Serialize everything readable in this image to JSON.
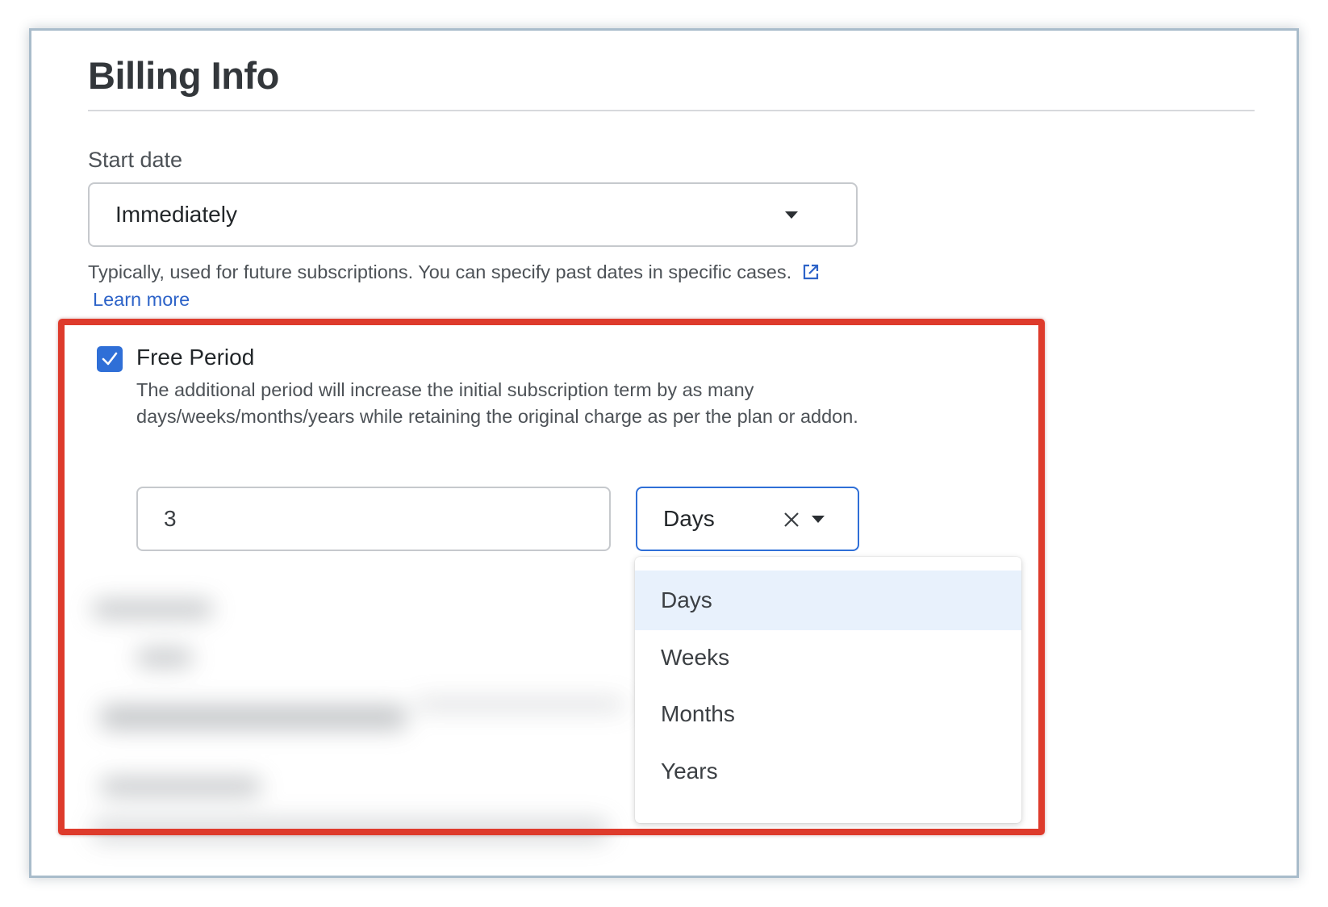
{
  "billing": {
    "title": "Billing Info",
    "start_date": {
      "label": "Start date",
      "value": "Immediately",
      "helper_text": "Typically, used for future subscriptions. You can specify past dates in specific cases.",
      "learn_more": "Learn more"
    },
    "free_period": {
      "checked": true,
      "label": "Free Period",
      "description": "The additional period will increase the initial subscription term by as many days/weeks/months/years while retaining the original charge as per the plan or addon.",
      "quantity": "3",
      "unit": "Days",
      "unit_options": [
        "Days",
        "Weeks",
        "Months",
        "Years"
      ],
      "selected_option": "Days"
    }
  },
  "colors": {
    "accent": "#2f6fd7",
    "link": "#2d63c8",
    "highlight_border": "#de3b2c",
    "selected_option_bg": "#e8f1fc"
  },
  "icons": {
    "checkbox": "check-icon",
    "link": "external-link-icon",
    "clear": "close-icon",
    "dropdown": "caret-down-icon"
  }
}
